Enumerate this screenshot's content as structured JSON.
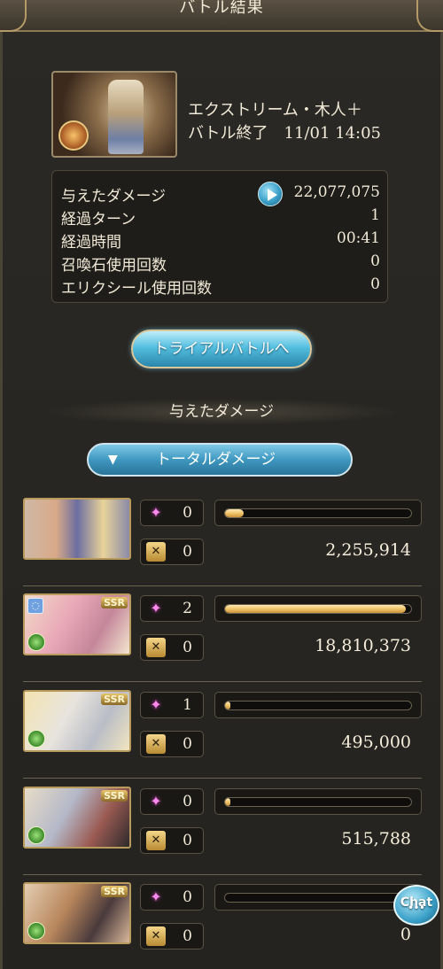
{
  "header": {
    "title": "バトル結果"
  },
  "quest": {
    "name": "エクストリーム・木人＋",
    "ended": "バトル終了　11/01 14:05",
    "element_icon": "fire-element-icon"
  },
  "stats": [
    {
      "label": "与えたダメージ",
      "value": "22,077,075"
    },
    {
      "label": "経過ターン",
      "value": "1"
    },
    {
      "label": "経過時間",
      "value": "00:41"
    },
    {
      "label": "召喚石使用回数",
      "value": "0"
    },
    {
      "label": "エリクシール使用回数",
      "value": "0"
    }
  ],
  "trial_button": "トライアルバトルへ",
  "section_label": "与えたダメージ",
  "total_dropdown": {
    "arrow": "▼",
    "label": "トータルダメージ"
  },
  "characters": [
    {
      "ca_count": "0",
      "skill_count": "0",
      "damage": "2,255,914",
      "share": 0.1
    },
    {
      "ssr": "SSR",
      "ca_count": "2",
      "skill_count": "0",
      "damage": "18,810,373",
      "share": 0.97
    },
    {
      "ssr": "SSR",
      "ca_count": "1",
      "skill_count": "0",
      "damage": "495,000",
      "share": 0.02
    },
    {
      "ssr": "SSR",
      "ca_count": "0",
      "skill_count": "0",
      "damage": "515,788",
      "share": 0.02
    },
    {
      "ssr": "SSR",
      "ca_count": "0",
      "skill_count": "0",
      "damage": "0",
      "share": 0.0
    }
  ],
  "chat": {
    "label": "Chat",
    "dots": "•••"
  },
  "colors": {
    "accent_blue": "#3a9fc8",
    "bar_fill": "#f0c46a",
    "frame_gold": "#b79a5c"
  }
}
